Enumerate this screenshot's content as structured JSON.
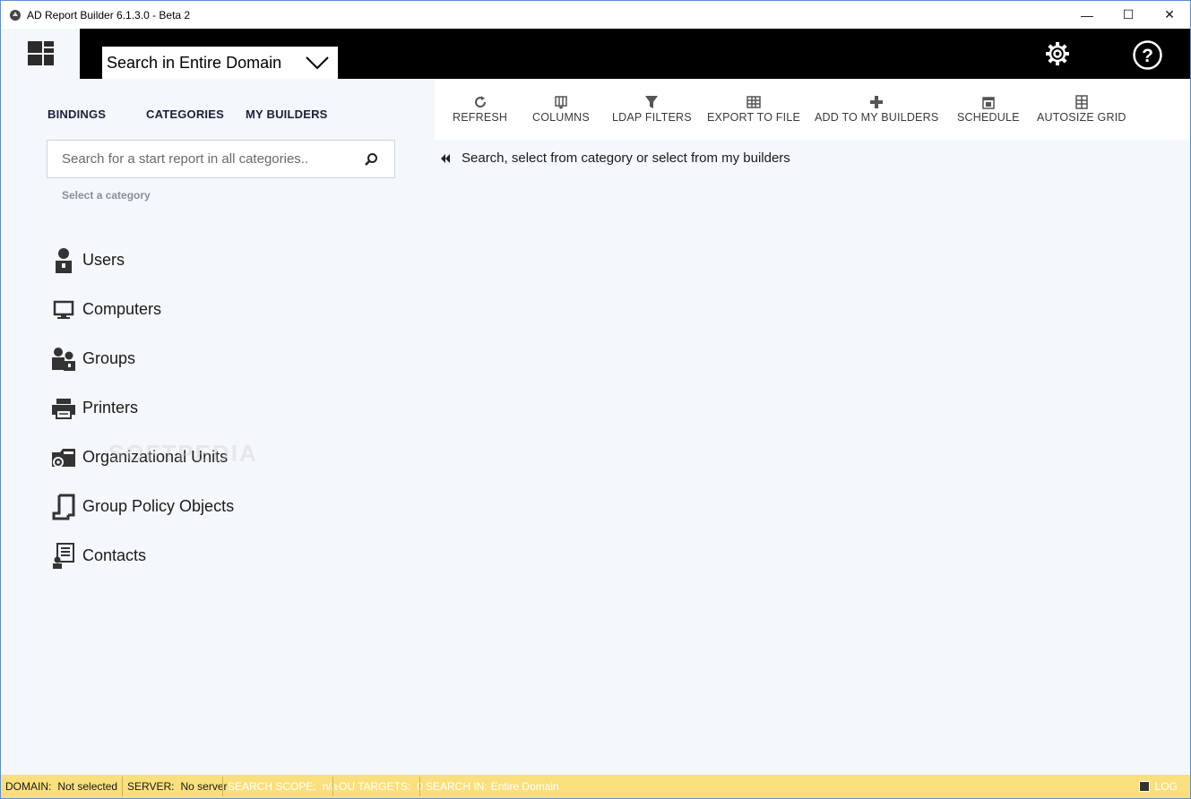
{
  "window": {
    "title": "AD Report Builder 6.1.3.0 - Beta 2",
    "minimize": "—",
    "maximize": "☐",
    "close": "✕"
  },
  "header": {
    "domain_select_label": "Search in Entire Domain"
  },
  "left": {
    "tabs": [
      "BINDINGS",
      "CATEGORIES",
      "MY BUILDERS"
    ],
    "search_placeholder": "Search for a start report in all categories..",
    "select_category": "Select a category",
    "categories": [
      {
        "label": "Users",
        "icon": "user-icon"
      },
      {
        "label": "Computers",
        "icon": "computer-icon"
      },
      {
        "label": "Groups",
        "icon": "groups-icon"
      },
      {
        "label": "Printers",
        "icon": "printer-icon"
      },
      {
        "label": "Organizational Units",
        "icon": "folder-icon"
      },
      {
        "label": "Group Policy Objects",
        "icon": "policy-icon"
      },
      {
        "label": "Contacts",
        "icon": "contacts-icon"
      }
    ]
  },
  "toolbar": {
    "refresh": "REFRESH",
    "columns": "COLUMNS",
    "ldap_filters": "LDAP FILTERS",
    "export": "EXPORT TO FILE",
    "add_builders": "ADD TO MY BUILDERS",
    "schedule": "SCHEDULE",
    "autosize": "AUTOSIZE GRID"
  },
  "main": {
    "hint": "Search, select from category or select from my builders"
  },
  "status": {
    "domain_key": "DOMAIN:",
    "domain_val": "Not selected",
    "server_key": "SERVER:",
    "server_val": "No server",
    "scope_key": "SEARCH SCOPE:",
    "scope_val": "n/a",
    "ou_key": "OU TARGETS:",
    "ou_val": "0",
    "searchin_key": "SEARCH IN:",
    "searchin_val": "Entire Domain",
    "log": "LOG"
  },
  "watermark": "SOFTPEDIA",
  "colors": {
    "header": "#000000",
    "panel": "#f4f7fb",
    "statusbar": "#f9e07c"
  }
}
